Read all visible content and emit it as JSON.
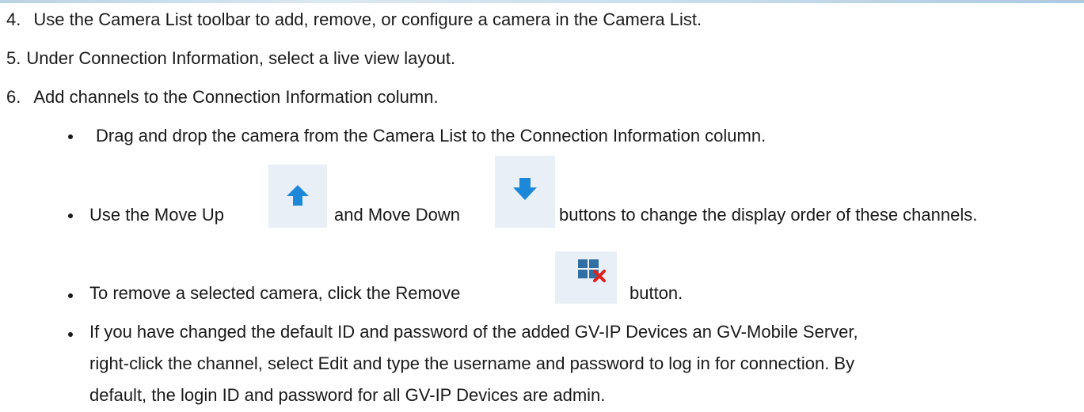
{
  "steps": [
    {
      "number": "4.",
      "text": "Use the Camera List toolbar to add, remove, or configure a camera in the Camera List."
    },
    {
      "number": "5.",
      "text": "Under Connection Information, select a live view layout."
    },
    {
      "number": "6.",
      "text": "Add channels to the Connection Information column."
    }
  ],
  "bullets": {
    "drag": "Drag and drop the camera from the Camera List to the Connection Information column.",
    "move_prefix": "Use the Move Up",
    "move_middle": "and Move Down",
    "move_suffix": "buttons to change the display order of these channels.",
    "remove_prefix": "To remove a selected camera, click the Remove",
    "remove_suffix": "button.",
    "password_line1": "If you have changed the default ID and password of the added GV-IP Devices an  GV-Mobile Server,",
    "password_line2": "right-click the channel, select Edit and type the username and password to log in for connection. By",
    "password_line3": "default, the login ID and password for all GV-IP Devices are admin."
  },
  "icons": {
    "move_up": "arrow-up-icon",
    "move_down": "arrow-down-icon",
    "remove": "grid-remove-icon"
  },
  "colors": {
    "arrow_blue": "#1e88d8",
    "remove_red": "#e0201b",
    "grid_blue": "#2f6fa3",
    "icon_bg": "#e8eff6"
  }
}
